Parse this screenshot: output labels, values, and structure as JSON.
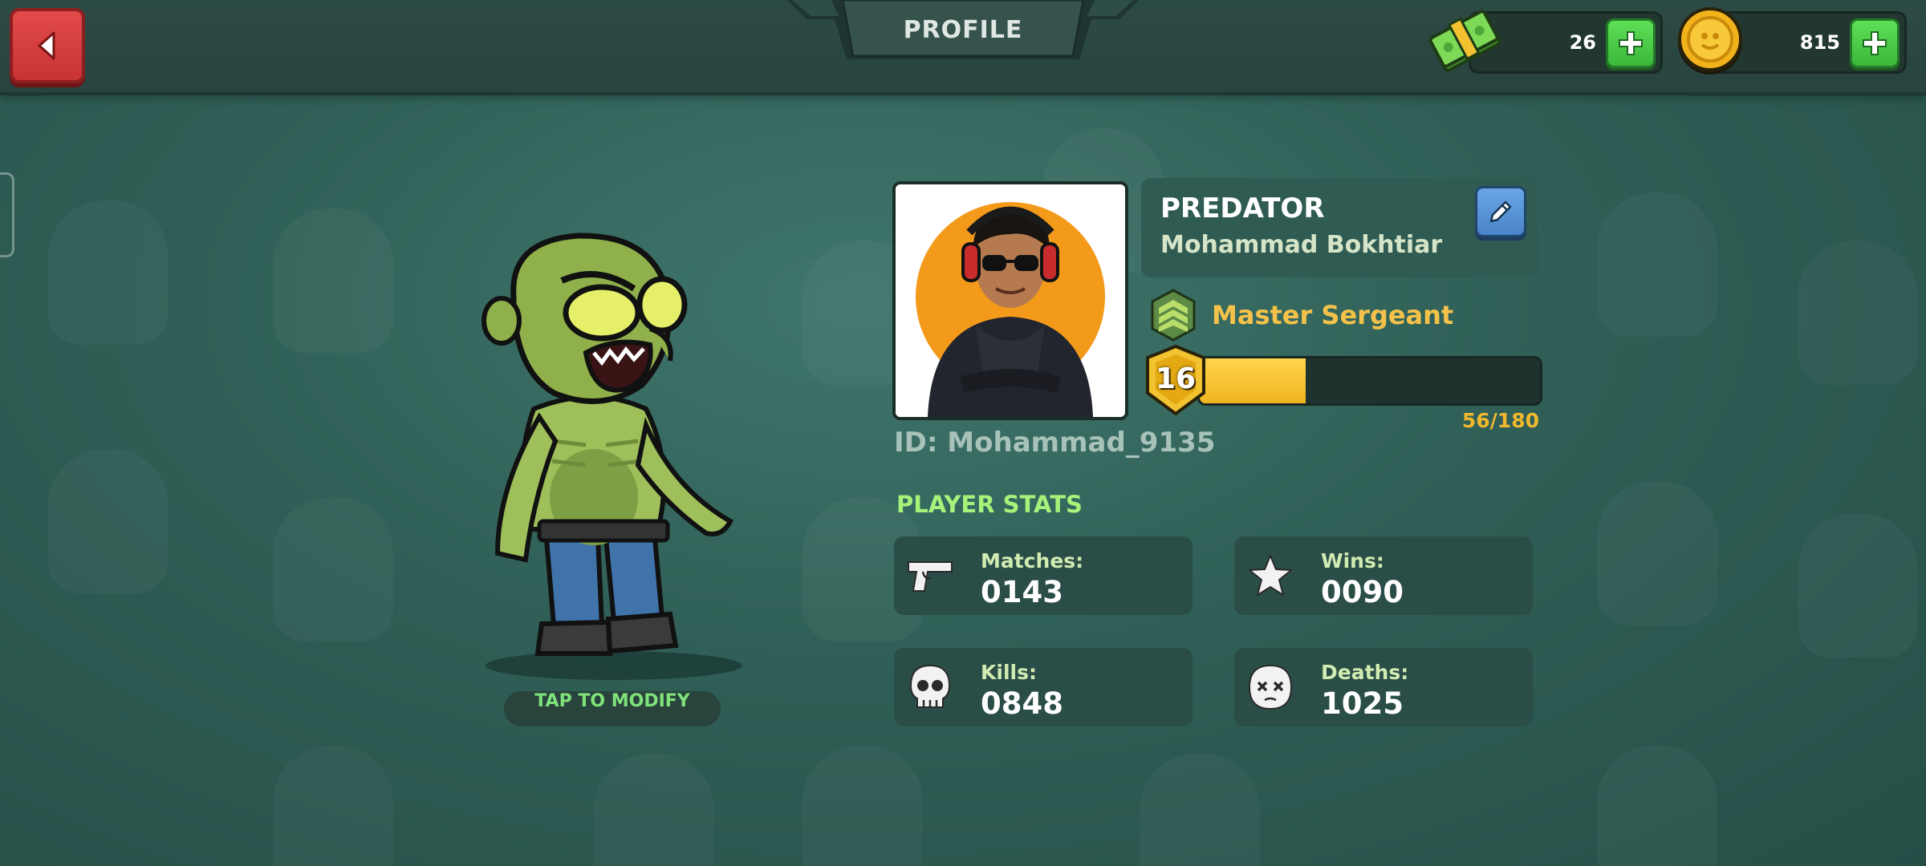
{
  "header": {
    "title": "PROFILE",
    "back_icon": "back-arrow-icon"
  },
  "currencies": [
    {
      "icon": "cash-bundle-icon",
      "value": "26"
    },
    {
      "icon": "gold-coin-icon",
      "value": "815"
    }
  ],
  "character": {
    "modify_label": "TAP TO MODIFY"
  },
  "profile": {
    "nickname": "PREDATOR",
    "full_name": "Mohammad Bokhtiar",
    "rank": "Master Sergeant",
    "level": "16",
    "xp_text": "56/180",
    "xp_current": 56,
    "xp_max": 180,
    "player_id": "ID: Mohammad_9135"
  },
  "stats": {
    "title": "PLAYER STATS",
    "items": [
      {
        "label": "Matches:",
        "value": "0143",
        "icon": "pistol-icon"
      },
      {
        "label": "Wins:",
        "value": "0090",
        "icon": "star-icon"
      },
      {
        "label": "Kills:",
        "value": "0848",
        "icon": "skull-icon"
      },
      {
        "label": "Deaths:",
        "value": "1025",
        "icon": "dead-face-icon"
      }
    ]
  },
  "colors": {
    "accent_gold": "#f4c24a",
    "stats_green": "#a6f27a",
    "back_red": "#d63a3a",
    "plus_green": "#4cc947"
  }
}
